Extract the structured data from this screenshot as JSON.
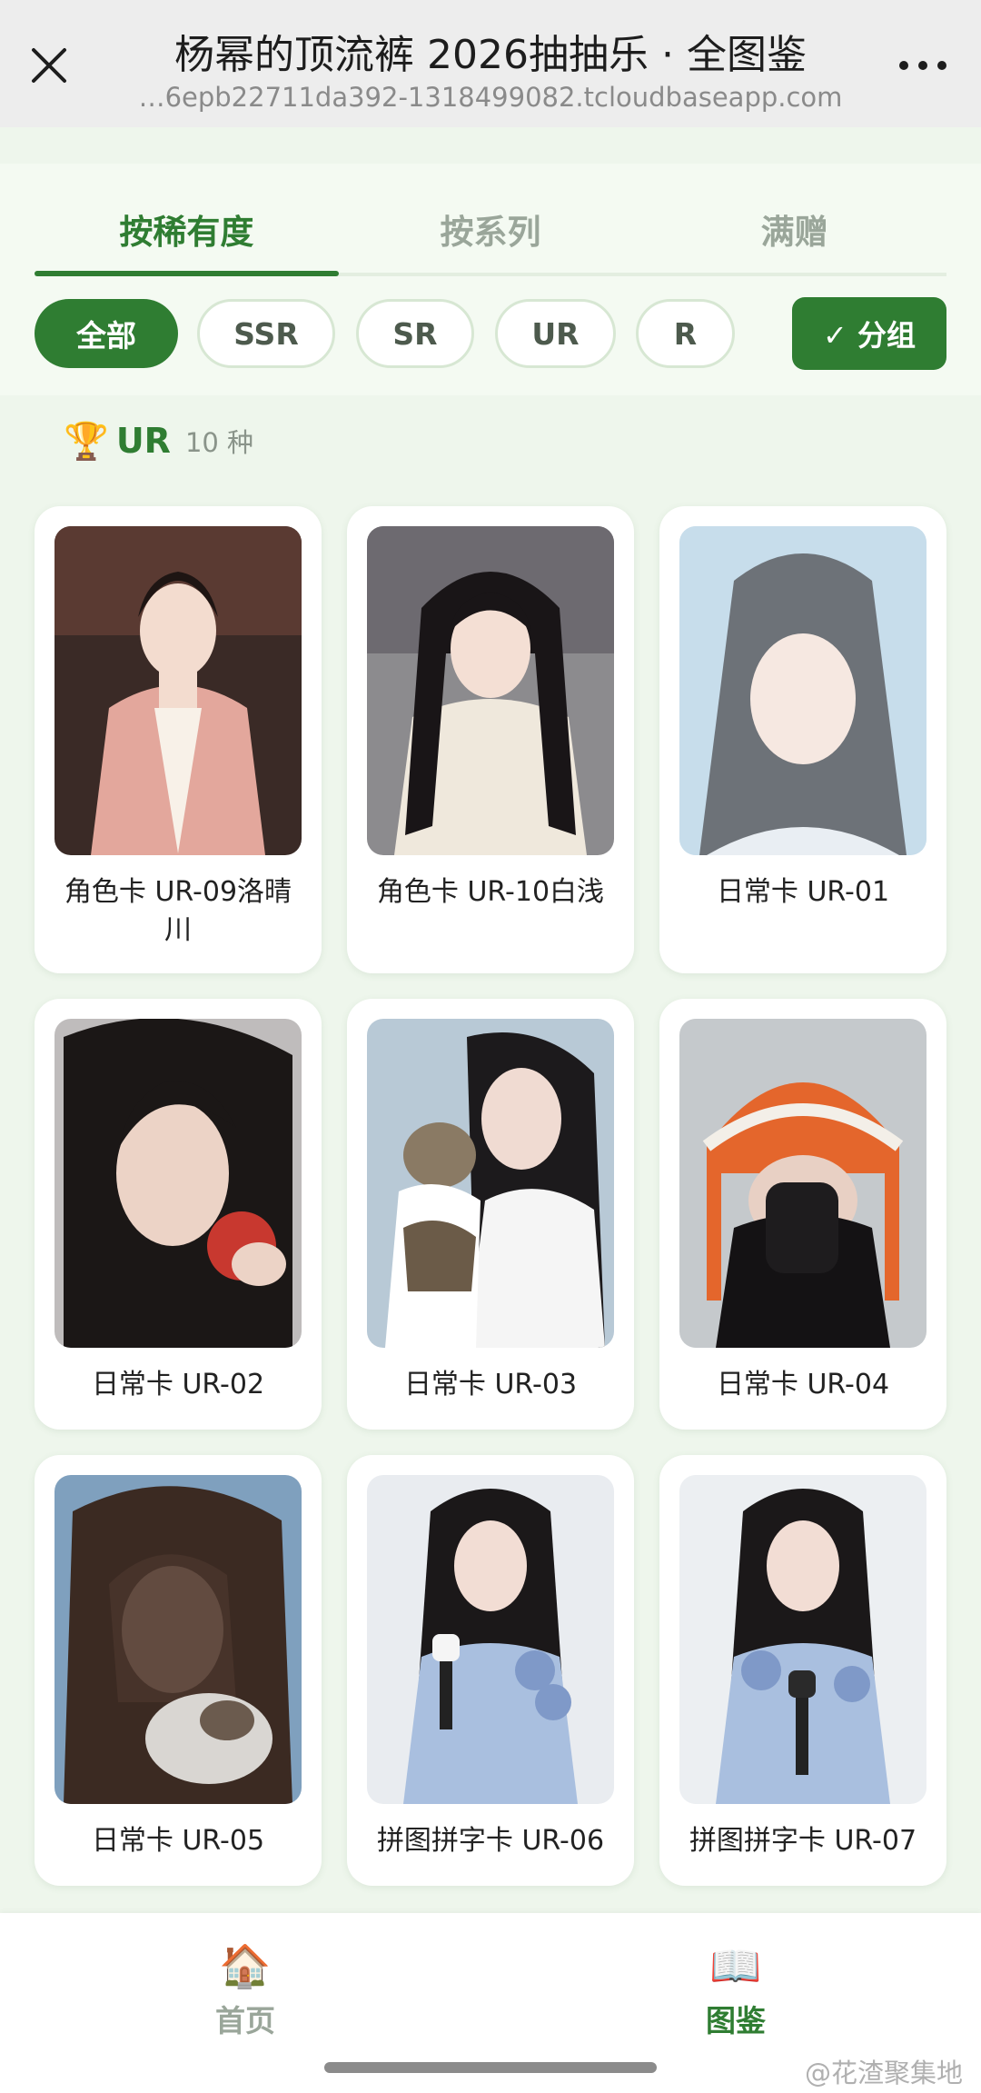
{
  "header": {
    "title": "杨幂的顶流裤 2026抽抽乐 · 全图鉴",
    "url": "…6epb22711da392-1318499082.tcloudbaseapp.com"
  },
  "tabs": [
    {
      "label": "按稀有度",
      "active": true
    },
    {
      "label": "按系列",
      "active": false
    },
    {
      "label": "满赠",
      "active": false
    }
  ],
  "filters": [
    {
      "label": "全部",
      "selected": true
    },
    {
      "label": "SSR",
      "selected": false
    },
    {
      "label": "SR",
      "selected": false
    },
    {
      "label": "UR",
      "selected": false
    },
    {
      "label": "R",
      "selected": false
    }
  ],
  "group_toggle": {
    "label": "✓ 分组",
    "checked": true
  },
  "section": {
    "icon": "trophy-icon",
    "rarity": "UR",
    "count": "10 种"
  },
  "cards": [
    {
      "label": "角色卡 UR-09洛晴川",
      "photo": "woman-portrait-pink-costume"
    },
    {
      "label": "角色卡 UR-10白浅",
      "photo": "woman-portrait-white-robe"
    },
    {
      "label": "日常卡 UR-01",
      "photo": "woman-portrait-veil"
    },
    {
      "label": "日常卡 UR-02",
      "photo": "woman-portrait-apple"
    },
    {
      "label": "日常卡 UR-03",
      "photo": "woman-portrait-cat"
    },
    {
      "label": "日常卡 UR-04",
      "photo": "woman-portrait-knit-hat"
    },
    {
      "label": "日常卡 UR-05",
      "photo": "woman-portrait-cat-hug"
    },
    {
      "label": "拼图拼字卡 UR-06",
      "photo": "woman-portrait-microphone"
    },
    {
      "label": "拼图拼字卡 UR-07",
      "photo": "woman-portrait-microphone"
    }
  ],
  "bottom_nav": [
    {
      "label": "首页",
      "icon": "house-icon",
      "active": false
    },
    {
      "label": "图鉴",
      "icon": "book-icon",
      "active": true
    }
  ],
  "watermark": "@花渣聚集地",
  "colors": {
    "accent": "#2f7d32",
    "background": "#eef6ec",
    "muted": "#9aa69a"
  }
}
